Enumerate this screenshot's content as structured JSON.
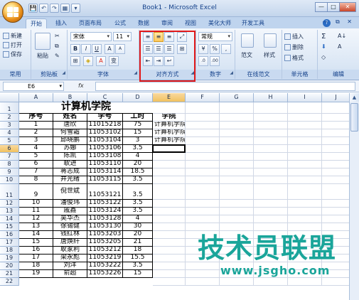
{
  "window": {
    "title": "Book1 - Microsoft Excel",
    "buttons": [
      "—",
      "□",
      "✕"
    ]
  },
  "qat": [
    "💾",
    "↶",
    "↷",
    "▦",
    "▾"
  ],
  "tabs": [
    {
      "label": "开始",
      "active": true
    },
    {
      "label": "插入"
    },
    {
      "label": "页面布局"
    },
    {
      "label": "公式"
    },
    {
      "label": "数据"
    },
    {
      "label": "审阅"
    },
    {
      "label": "视图"
    },
    {
      "label": "美化大师"
    },
    {
      "label": "开发工具"
    }
  ],
  "ribbon_right": {
    "help": "?",
    "controls": "— ⧉ ✕"
  },
  "ribbon": {
    "clipboard": {
      "new": "新建",
      "open": "打开",
      "save": "保存",
      "paste": "粘贴",
      "common_label": "常用",
      "label": "剪贴板"
    },
    "font": {
      "name": "宋体",
      "size": "11",
      "bold": "B",
      "italic": "I",
      "underline": "U",
      "grow": "A",
      "shrink": "A",
      "border": "⊞",
      "fill": "◈",
      "color": "A",
      "phonetic": "变",
      "label": "字体"
    },
    "alignment": {
      "label": "对齐方式"
    },
    "number": {
      "format": "常规",
      "percent": "%",
      "comma": ",",
      "label": "数字"
    },
    "style": {
      "template": "范文",
      "style": "样式",
      "label": "在线范文"
    },
    "cells": {
      "insert": "插入",
      "delete": "删除",
      "format": "格式",
      "label": "单元格"
    },
    "editing": {
      "sum": "Σ",
      "sort": "A↓",
      "find": "A",
      "fill": "⬇",
      "clear": "◇",
      "label": "编辑"
    }
  },
  "formula_bar": {
    "name_box": "E6",
    "fx": "fx",
    "value": ""
  },
  "columns": [
    "A",
    "B",
    "C",
    "D",
    "E",
    "F",
    "G",
    "H",
    "I",
    "J"
  ],
  "sheet": {
    "title": "计算机学院",
    "headers": [
      "序号",
      "姓名",
      "学号",
      "工时"
    ],
    "college_header": "学院",
    "college_values": [
      "计算机学院",
      "计算机学院",
      "计算机学院"
    ],
    "rows": [
      [
        "1",
        "唐欣",
        "11015218",
        "75"
      ],
      [
        "2",
        "何雪霜",
        "11053102",
        "15"
      ],
      [
        "3",
        "邱晓鹏",
        "11053104",
        "3"
      ],
      [
        "4",
        "苏娜",
        "11053106",
        "3.5"
      ],
      [
        "5",
        "陈凯",
        "11053108",
        "4"
      ],
      [
        "6",
        "耿进",
        "11053110",
        "20"
      ],
      [
        "7",
        "蒋志成",
        "11053114",
        "18.5"
      ],
      [
        "8",
        "井光绪",
        "11053115",
        "3.5"
      ],
      [
        "9",
        "倪世斌",
        "11053121",
        "3.5"
      ],
      [
        "10",
        "潘俊玮",
        "11053122",
        "3.5"
      ],
      [
        "11",
        "戚鑫",
        "11053124",
        "3.5"
      ],
      [
        "12",
        "吴华杰",
        "11053128",
        "4"
      ],
      [
        "13",
        "徐锡健",
        "11053130",
        "30"
      ],
      [
        "14",
        "钱红林",
        "11053203",
        "20"
      ],
      [
        "15",
        "唐焕纤",
        "11053205",
        "21"
      ],
      [
        "16",
        "耿家利",
        "11053212",
        "18"
      ],
      [
        "17",
        "梁永彪",
        "11053219",
        "15.5"
      ],
      [
        "18",
        "刘洋",
        "11053222",
        "3.5"
      ],
      [
        "19",
        "俞超",
        "11053226",
        "15"
      ]
    ],
    "row_numbers": [
      "1",
      "2",
      "3",
      "4",
      "5",
      "6",
      "7",
      "8",
      "9",
      "10",
      "11",
      "12",
      "13",
      "14",
      "15",
      "16",
      "17",
      "18",
      "19",
      "20",
      "21",
      "22"
    ]
  },
  "watermark": {
    "cn": "技术员联盟",
    "url": "www.jsgho.com",
    "color": "#1aa59a"
  },
  "colors": {
    "highlight": "#e21a1a",
    "selection": "#f1c15f"
  }
}
